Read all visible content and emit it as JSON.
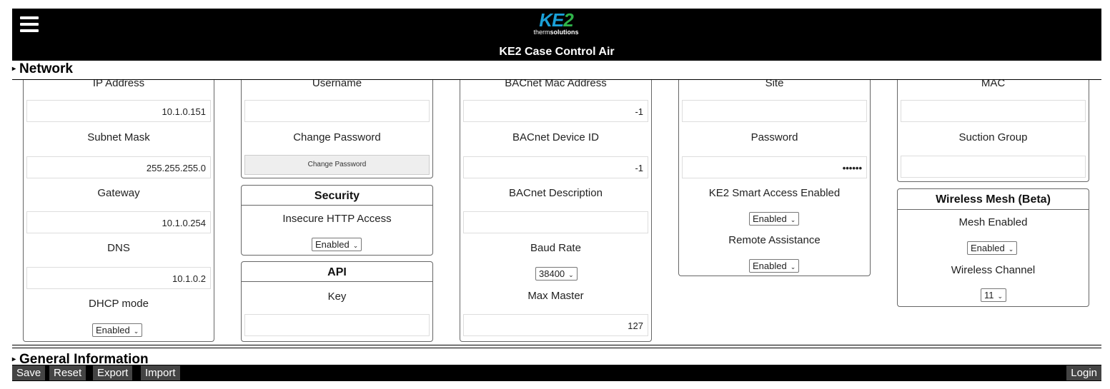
{
  "header": {
    "logo_text": "KE2",
    "logo_sub_thin": "therm",
    "logo_sub_bold": "solutions",
    "app_title": "KE2 Case Control Air"
  },
  "network": {
    "title": "Network",
    "col1": {
      "ip_label": "IP Address",
      "ip_value": "10.1.0.151",
      "subnet_label": "Subnet Mask",
      "subnet_value": "255.255.255.0",
      "gateway_label": "Gateway",
      "gateway_value": "10.1.0.254",
      "dns_label": "DNS",
      "dns_value": "10.1.0.2",
      "dhcp_label": "DHCP mode",
      "dhcp_value": "Enabled"
    },
    "col2": {
      "username_label": "Username",
      "username_value": "",
      "change_password_label": "Change Password",
      "change_password_button": "Change Password",
      "security_title": "Security",
      "insecure_http_label": "Insecure HTTP Access",
      "insecure_http_value": "Enabled",
      "api_title": "API",
      "key_label": "Key",
      "key_value": ""
    },
    "col3": {
      "bacnet_mac_label": "BACnet Mac Address",
      "bacnet_mac_value": "-1",
      "bacnet_device_label": "BACnet Device ID",
      "bacnet_device_value": "-1",
      "bacnet_desc_label": "BACnet Description",
      "bacnet_desc_value": "",
      "baud_label": "Baud Rate",
      "baud_value": "38400",
      "max_master_label": "Max Master",
      "max_master_value": "127"
    },
    "col4": {
      "site_label": "Site",
      "site_value": "",
      "password_label": "Password",
      "password_value": "••••••",
      "smart_access_label": "KE2 Smart Access Enabled",
      "smart_access_value": "Enabled",
      "remote_label": "Remote Assistance",
      "remote_value": "Enabled"
    },
    "col5": {
      "mac_label": "MAC",
      "mac_value": "",
      "suction_label": "Suction Group",
      "suction_value": "",
      "mesh_title": "Wireless Mesh (Beta)",
      "mesh_enabled_label": "Mesh Enabled",
      "mesh_enabled_value": "Enabled",
      "channel_label": "Wireless Channel",
      "channel_value": "11"
    }
  },
  "general": {
    "title": "General Information"
  },
  "footer": {
    "save": "Save",
    "reset": "Reset",
    "export": "Export",
    "import": "Import",
    "login": "Login"
  }
}
